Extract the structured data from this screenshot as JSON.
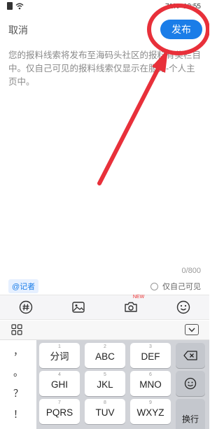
{
  "status_bar": {
    "battery_percent": "71%",
    "time": "10:55"
  },
  "header": {
    "cancel_label": "取消",
    "publish_label": "发布"
  },
  "editor": {
    "placeholder": "您的报料线索将发布至海码头社区的报料有奖栏目中。仅自己可见的报料线索仅显示在服务-个人主页中。",
    "char_counter": "0/800",
    "reporter_tag": "@记者",
    "self_visible_label": "仅自己可见"
  },
  "toolbar": {
    "items": [
      {
        "icon": "hashtag-icon"
      },
      {
        "icon": "image-icon"
      },
      {
        "icon": "camera-icon",
        "badge": "NEW"
      },
      {
        "icon": "emoji-icon"
      }
    ]
  },
  "keyboard": {
    "punctuation": [
      "，",
      "。",
      "？",
      "！"
    ],
    "keys": [
      {
        "num": "1",
        "label": "分词"
      },
      {
        "num": "2",
        "label": "ABC"
      },
      {
        "num": "3",
        "label": "DEF"
      },
      {
        "num": "4",
        "label": "GHI"
      },
      {
        "num": "5",
        "label": "JKL"
      },
      {
        "num": "6",
        "label": "MNO"
      },
      {
        "num": "7",
        "label": "PQRS"
      },
      {
        "num": "8",
        "label": "TUV"
      },
      {
        "num": "9",
        "label": "WXYZ"
      }
    ],
    "enter_label": "换行"
  },
  "colors": {
    "accent": "#1a7de8",
    "annotation": "#e8303a"
  }
}
